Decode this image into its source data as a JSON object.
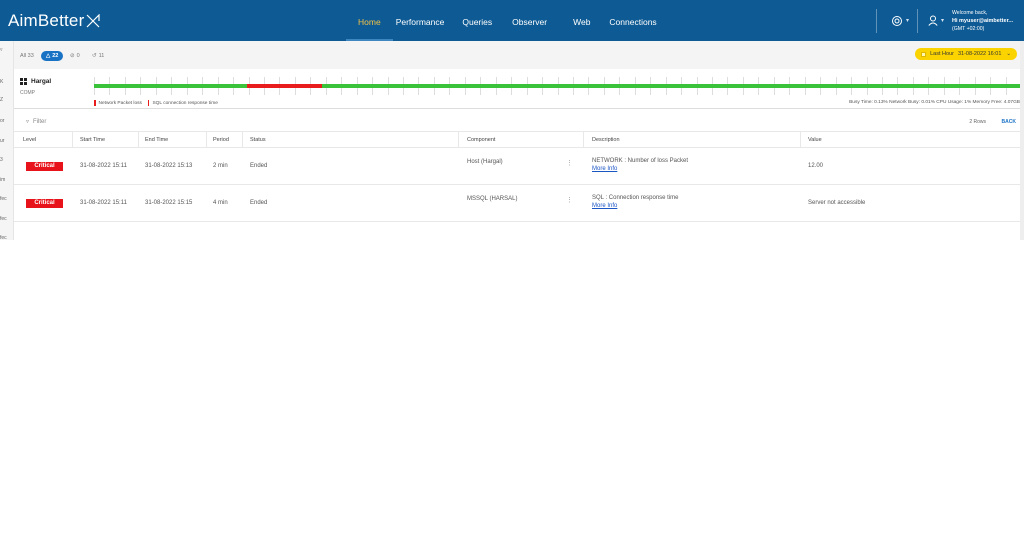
{
  "app": {
    "logo": "AimBetter"
  },
  "nav": [
    {
      "label": "Home",
      "active": true
    },
    {
      "label": "Performance"
    },
    {
      "label": "Queries"
    },
    {
      "label": "Observer"
    },
    {
      "label": "Web"
    },
    {
      "label": "Connections"
    }
  ],
  "user": {
    "welcome": "Welcome back,",
    "name": "Hi myuser@aimbetter...",
    "tz": "(GMT +02:00)"
  },
  "filters": {
    "all": "All 33",
    "alerts": "22",
    "noconn": "0",
    "resolved": "11"
  },
  "time_range": {
    "label": "Last Hour",
    "value": "31-08-2022 16:01"
  },
  "host": {
    "name": "Hargal",
    "sub": "COMP",
    "legend": [
      "Network Packet loss",
      "SQL connection response time"
    ],
    "stats": "Busy Time: 0.13%   Network Busy: 0.01%   CPU Usage: 1%   Memory Free: 4.07GB"
  },
  "panel": {
    "filter": "Filter",
    "rows": "2 Rows",
    "back": "BACK"
  },
  "columns": [
    "Level",
    "Start Time",
    "End Time",
    "Period",
    "Status",
    "Component",
    "Description",
    "Value"
  ],
  "rows": [
    {
      "level": "Critical",
      "start": "31-08-2022 15:11",
      "end": "31-08-2022 15:13",
      "period": "2 min",
      "status": "Ended",
      "component": "Host (Hargal)",
      "desc": "NETWORK : Number of loss Packet",
      "more": "More Info",
      "value": "12.00"
    },
    {
      "level": "Critical",
      "start": "31-08-2022 15:11",
      "end": "31-08-2022 15:15",
      "period": "4 min",
      "status": "Ended",
      "component": "MSSQL (HARSAL)",
      "desc": "SQL : Connection response time",
      "more": "More Info",
      "value": "Server not accessible"
    }
  ],
  "sidebar_fragments": [
    "K",
    "Z",
    "or",
    "ur",
    "3",
    "im",
    "fec",
    "fec",
    "fec"
  ],
  "colors": {
    "header": "#0d5a94",
    "active_nav": "#f3c246",
    "critical": "#e8131a",
    "ok_timeline": "#3ac23a",
    "alert_timeline": "#e81c1c",
    "time_pill": "#fbd400"
  }
}
